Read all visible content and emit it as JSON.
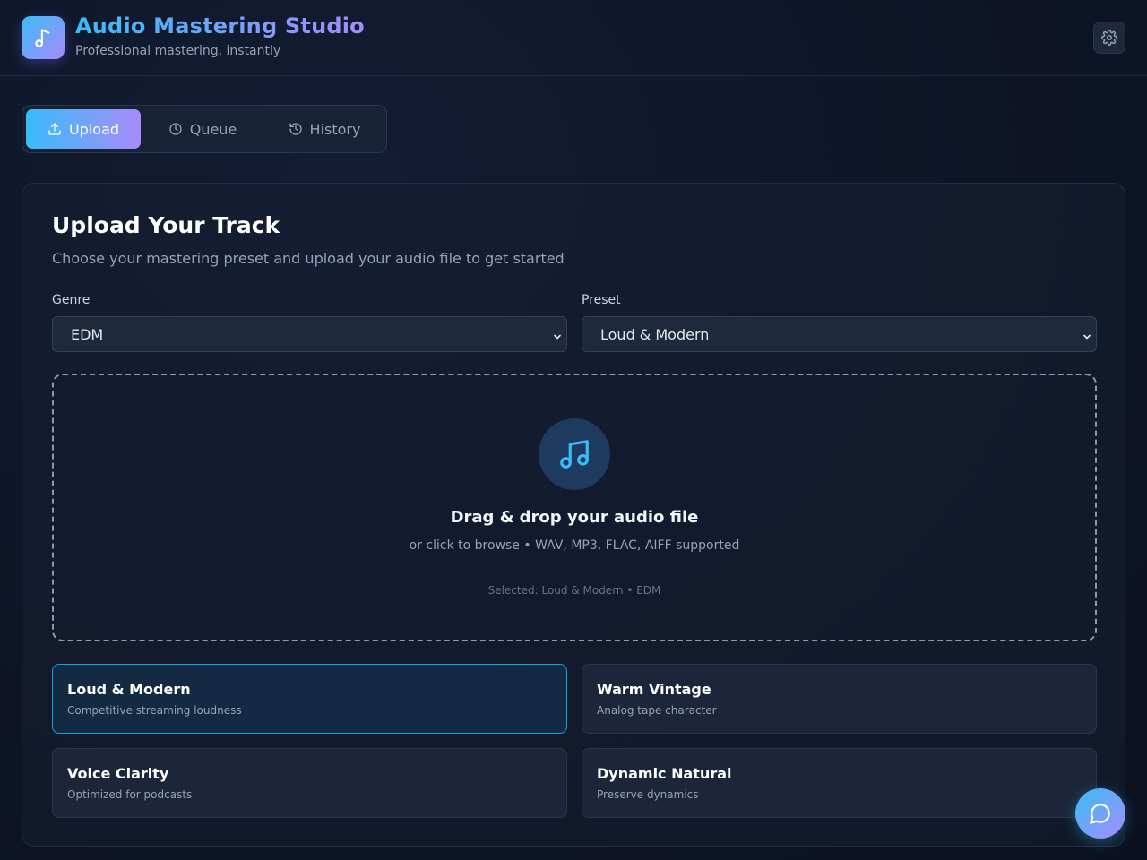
{
  "app": {
    "title": "Audio Mastering Studio",
    "subtitle": "Professional mastering, instantly",
    "logo_icon": "music-note-icon",
    "settings_icon": "gear-icon"
  },
  "tabs": [
    {
      "label": "Upload",
      "icon": "upload-icon",
      "active": true
    },
    {
      "label": "Queue",
      "icon": "clock-icon",
      "active": false
    },
    {
      "label": "History",
      "icon": "history-icon",
      "active": false
    }
  ],
  "upload_panel": {
    "title": "Upload Your Track",
    "subtitle": "Choose your mastering preset and upload your audio file to get started",
    "genre": {
      "label": "Genre",
      "value": "EDM"
    },
    "preset": {
      "label": "Preset",
      "value": "Loud & Modern"
    },
    "dropzone": {
      "icon": "music-notes-icon",
      "title": "Drag & drop your audio file",
      "subtitle": "or click to browse • WAV, MP3, FLAC, AIFF supported",
      "selected": "Selected: Loud & Modern • EDM"
    },
    "presets": [
      {
        "name": "Loud & Modern",
        "desc": "Competitive streaming loudness",
        "selected": true
      },
      {
        "name": "Warm Vintage",
        "desc": "Analog tape character",
        "selected": false
      },
      {
        "name": "Voice Clarity",
        "desc": "Optimized for podcasts",
        "selected": false
      },
      {
        "name": "Dynamic Natural",
        "desc": "Preserve dynamics",
        "selected": false
      }
    ]
  },
  "chat": {
    "icon": "chat-bubble-icon"
  },
  "colors": {
    "accent_start": "#38bdf8",
    "accent_end": "#a78bfa",
    "background": "#0f172a",
    "selected_border": "#0ea5e9"
  }
}
